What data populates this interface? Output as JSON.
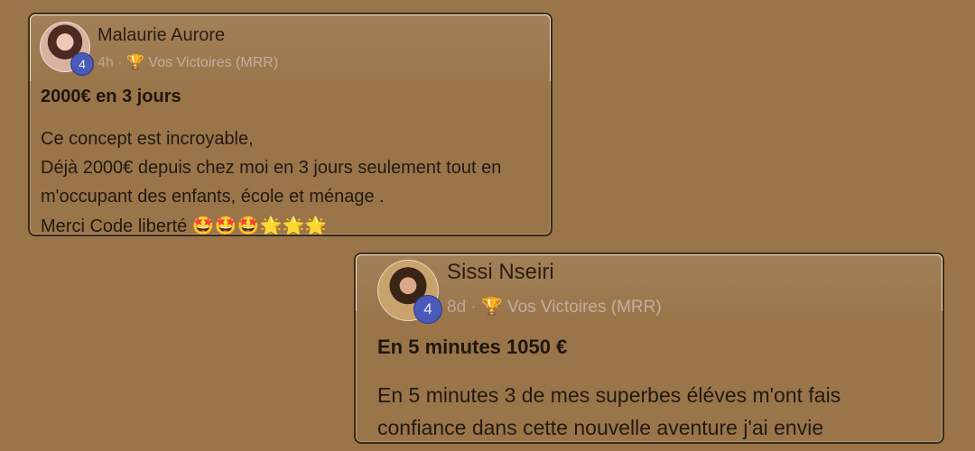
{
  "posts": [
    {
      "author": "Malaurie Aurore",
      "badge": "4",
      "time": "4h",
      "separator": "·",
      "trophy": "🏆",
      "category": "Vos Victoires (MRR)",
      "title": "2000€ en 3 jours",
      "lines": [
        "Ce concept est incroyable,",
        "Déjà 2000€ depuis chez moi en 3 jours seulement tout en",
        "m'occupant des enfants, école et ménage .",
        "Merci Code liberté"
      ],
      "emojis": "🤩🤩🤩🌟🌟🌟"
    },
    {
      "author": "Sissi Nseiri",
      "badge": "4",
      "time": "8d",
      "separator": "·",
      "trophy": "🏆",
      "category": "Vos Victoires (MRR)",
      "title": "En 5 minutes 1050 €",
      "lines": [
        "En 5 minutes 3 de mes superbes éléves m'ont fais",
        "confiance dans cette nouvelle aventure j'ai envie"
      ]
    }
  ]
}
